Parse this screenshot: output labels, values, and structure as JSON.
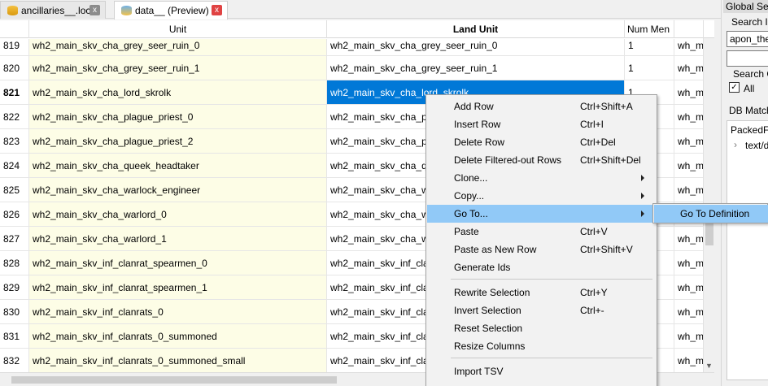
{
  "tabs": [
    {
      "label": "ancillaries__.loc",
      "close": "x"
    },
    {
      "label": "data__ (Preview)",
      "close": "x"
    }
  ],
  "table": {
    "headers": [
      "Unit",
      "Land Unit",
      "Num Men"
    ],
    "rows": [
      {
        "n": "819",
        "unit": "wh2_main_skv_cha_grey_seer_ruin_0",
        "land": "wh2_main_skv_cha_grey_seer_ruin_0",
        "men": "1",
        "wh": "wh_m"
      },
      {
        "n": "820",
        "unit": "wh2_main_skv_cha_grey_seer_ruin_1",
        "land": "wh2_main_skv_cha_grey_seer_ruin_1",
        "men": "1",
        "wh": "wh_m"
      },
      {
        "n": "821",
        "unit": "wh2_main_skv_cha_lord_skrolk",
        "land": "wh2_main_skv_cha_lord_skrolk",
        "men": "1",
        "wh": "wh_m"
      },
      {
        "n": "822",
        "unit": "wh2_main_skv_cha_plague_priest_0",
        "land": "wh2_main_skv_cha_pla",
        "men": "",
        "wh": "wh_m"
      },
      {
        "n": "823",
        "unit": "wh2_main_skv_cha_plague_priest_2",
        "land": "wh2_main_skv_cha_pla",
        "men": "",
        "wh": "wh_m"
      },
      {
        "n": "824",
        "unit": "wh2_main_skv_cha_queek_headtaker",
        "land": "wh2_main_skv_cha_qu",
        "men": "",
        "wh": "wh_m"
      },
      {
        "n": "825",
        "unit": "wh2_main_skv_cha_warlock_engineer",
        "land": "wh2_main_skv_cha_wa",
        "men": "",
        "wh": "wh_m"
      },
      {
        "n": "826",
        "unit": "wh2_main_skv_cha_warlord_0",
        "land": "wh2_main_skv_cha_wa",
        "men": "",
        "wh": "wh_m"
      },
      {
        "n": "827",
        "unit": "wh2_main_skv_cha_warlord_1",
        "land": "wh2_main_skv_cha_wa",
        "men": "",
        "wh": "wh_m"
      },
      {
        "n": "828",
        "unit": "wh2_main_skv_inf_clanrat_spearmen_0",
        "land": "wh2_main_skv_inf_clar",
        "men": "",
        "wh": "wh_m"
      },
      {
        "n": "829",
        "unit": "wh2_main_skv_inf_clanrat_spearmen_1",
        "land": "wh2_main_skv_inf_clar",
        "men": "",
        "wh": "wh_m"
      },
      {
        "n": "830",
        "unit": "wh2_main_skv_inf_clanrats_0",
        "land": "wh2_main_skv_inf_clar",
        "men": "",
        "wh": "wh_m"
      },
      {
        "n": "831",
        "unit": "wh2_main_skv_inf_clanrats_0_summoned",
        "land": "wh2_main_skv_inf_clar",
        "men": "",
        "wh": "wh_m"
      },
      {
        "n": "832",
        "unit": "wh2_main_skv_inf_clanrats_0_summoned_small",
        "land": "wh2_main_skv_inf_clar",
        "men": "",
        "wh": "wh_m"
      }
    ]
  },
  "right_panel": {
    "title": "Global Search",
    "search_label": "Search In",
    "search_value": "apon_the_",
    "search_on_label": "Search On",
    "all_label": "All",
    "db_matches_label": "DB Matches",
    "tree_root": "PackedFile",
    "tree_child": "text/d"
  },
  "context_menu": {
    "items": [
      {
        "label": "Add Row",
        "shortcut": "Ctrl+Shift+A"
      },
      {
        "label": "Insert Row",
        "shortcut": "Ctrl+I"
      },
      {
        "label": "Delete Row",
        "shortcut": "Ctrl+Del"
      },
      {
        "label": "Delete Filtered-out Rows",
        "shortcut": "Ctrl+Shift+Del"
      },
      {
        "label": "Clone...",
        "shortcut": ""
      },
      {
        "label": "Copy...",
        "shortcut": ""
      },
      {
        "label": "Go To...",
        "shortcut": ""
      },
      {
        "label": "Paste",
        "shortcut": "Ctrl+V"
      },
      {
        "label": "Paste as New Row",
        "shortcut": "Ctrl+Shift+V"
      },
      {
        "label": "Generate Ids",
        "shortcut": ""
      },
      {
        "label": "Rewrite Selection",
        "shortcut": "Ctrl+Y"
      },
      {
        "label": "Invert Selection",
        "shortcut": "Ctrl+-"
      },
      {
        "label": "Reset Selection",
        "shortcut": ""
      },
      {
        "label": "Resize Columns",
        "shortcut": ""
      },
      {
        "label": "Import TSV",
        "shortcut": ""
      }
    ],
    "submenu_item": "Go To Definition"
  },
  "colors": {
    "selection": "#0078d7",
    "menu_highlight": "#91c9f7",
    "key_column": "#fdfde6"
  }
}
